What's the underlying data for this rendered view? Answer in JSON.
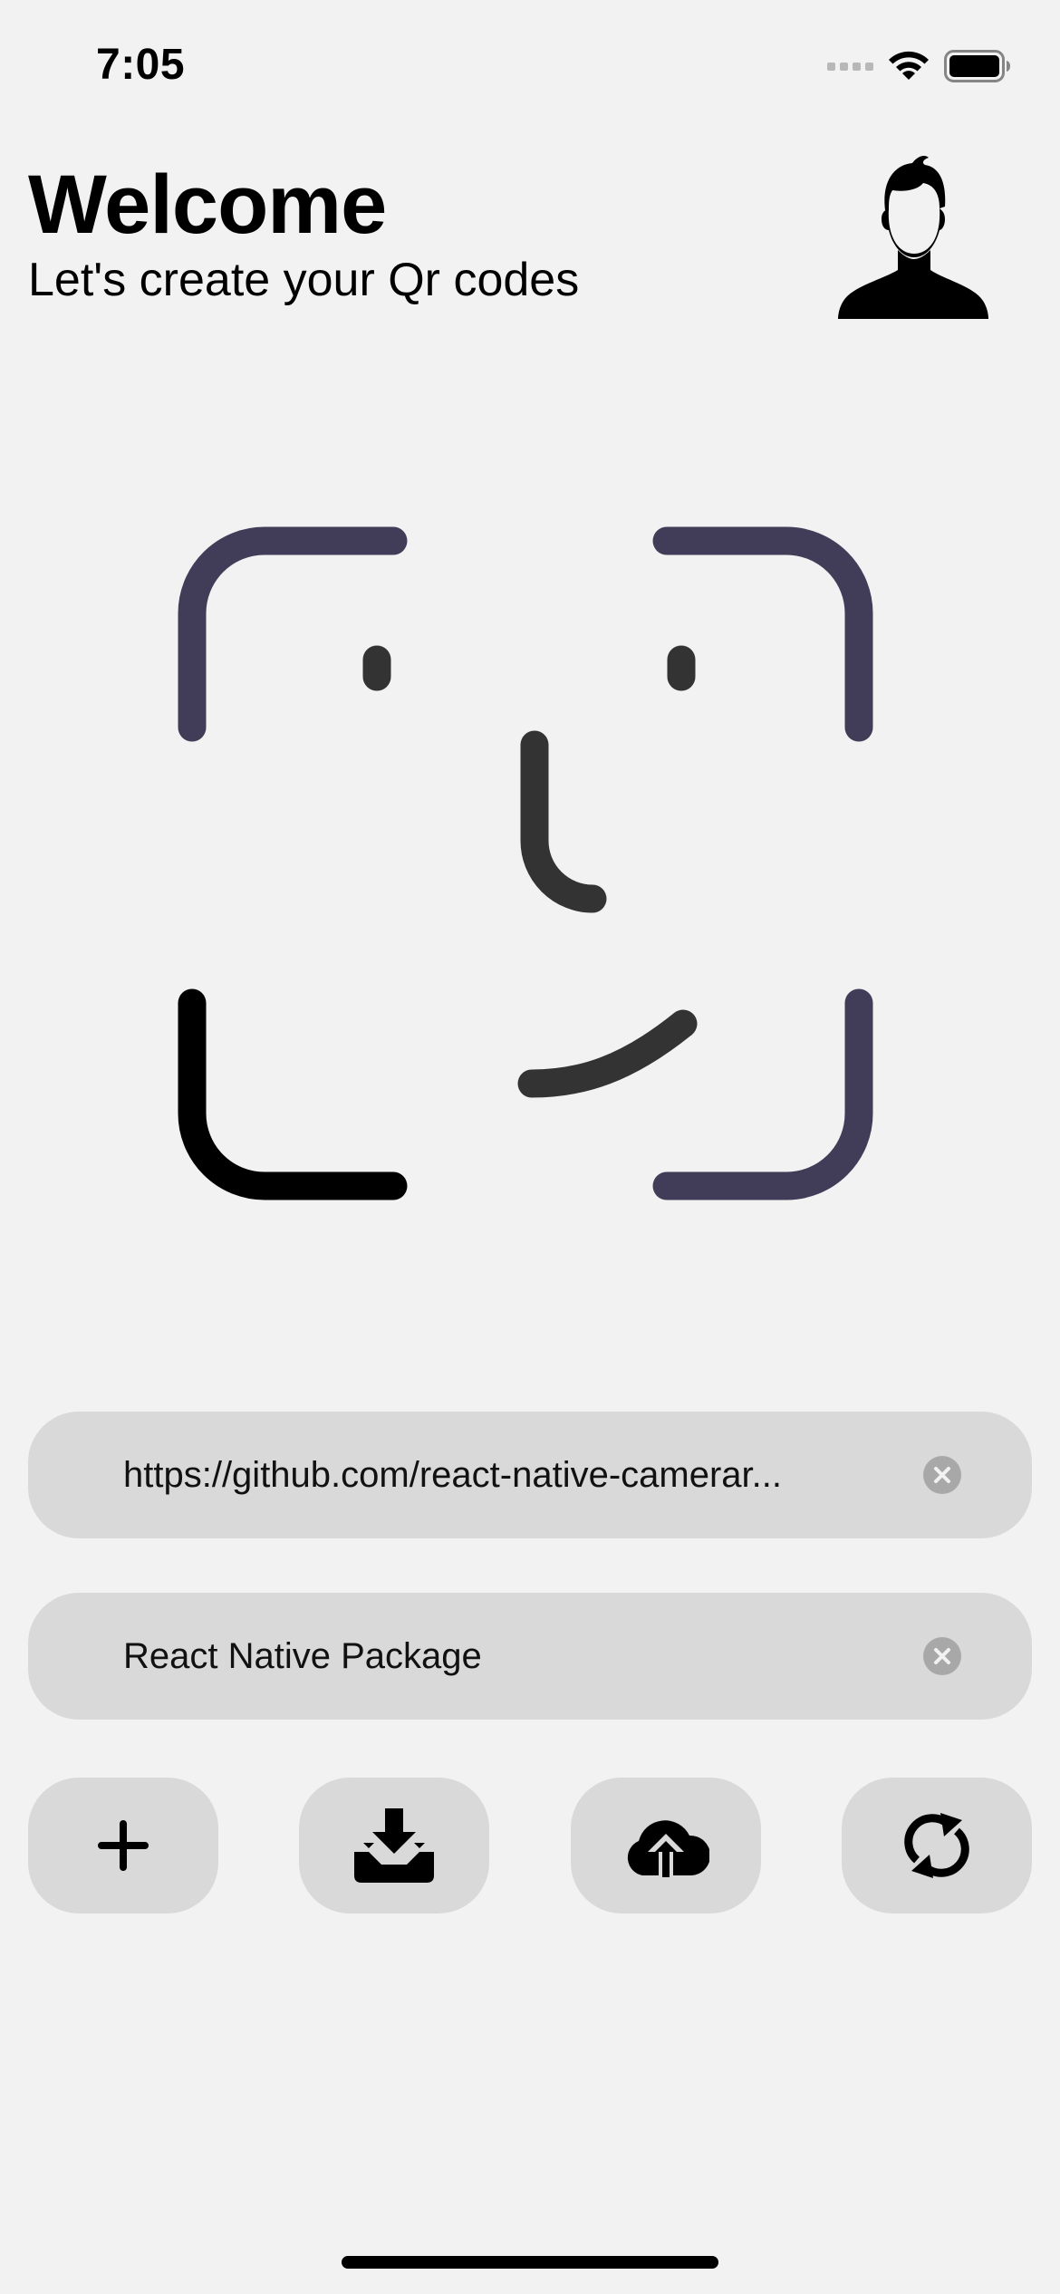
{
  "status_bar": {
    "time": "7:05"
  },
  "header": {
    "title": "Welcome",
    "subtitle": "Let's create your Qr codes"
  },
  "inputs": {
    "url_value": "https://github.com/react-native-camerar...",
    "name_value": "React Native Package"
  },
  "icons": {
    "profile": "person-silhouette-icon",
    "face_scan": "face-id-icon",
    "add": "plus-icon",
    "download": "download-tray-icon",
    "upload": "cloud-upload-icon",
    "refresh": "sync-icon"
  },
  "colors": {
    "background": "#f2f2f2",
    "field_background": "#d9d9d9",
    "frame_purple": "#413d58",
    "frame_dark": "#333333"
  }
}
